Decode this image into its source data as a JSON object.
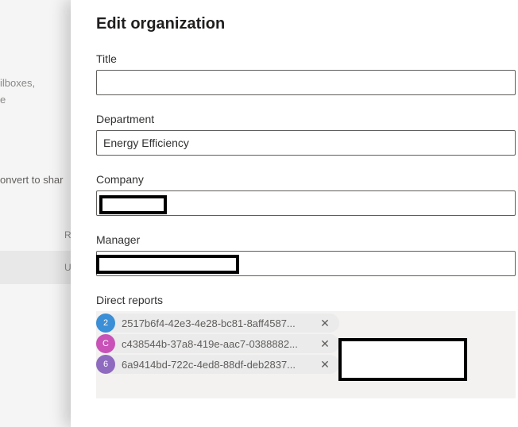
{
  "background": {
    "fragments": [
      "ilboxes,",
      "e",
      "onvert to shar",
      "R",
      "U"
    ]
  },
  "panel": {
    "title": "Edit organization",
    "fields": {
      "title": {
        "label": "Title",
        "value": ""
      },
      "department": {
        "label": "Department",
        "value": "Energy Efficiency"
      },
      "company": {
        "label": "Company",
        "value": ""
      },
      "manager": {
        "label": "Manager",
        "value": ""
      }
    },
    "direct_reports": {
      "label": "Direct reports",
      "items": [
        {
          "initial": "2",
          "name": "2517b6f4-42e3-4e28-bc81-8aff4587...",
          "color": "#3a8fd6"
        },
        {
          "initial": "C",
          "name": "c438544b-37a8-419e-aac7-0388882...",
          "color": "#c952b8"
        },
        {
          "initial": "6",
          "name": "6a9414bd-722c-4ed8-88df-deb2837...",
          "color": "#8e6bbf"
        }
      ],
      "remove_glyph": "✕"
    }
  }
}
